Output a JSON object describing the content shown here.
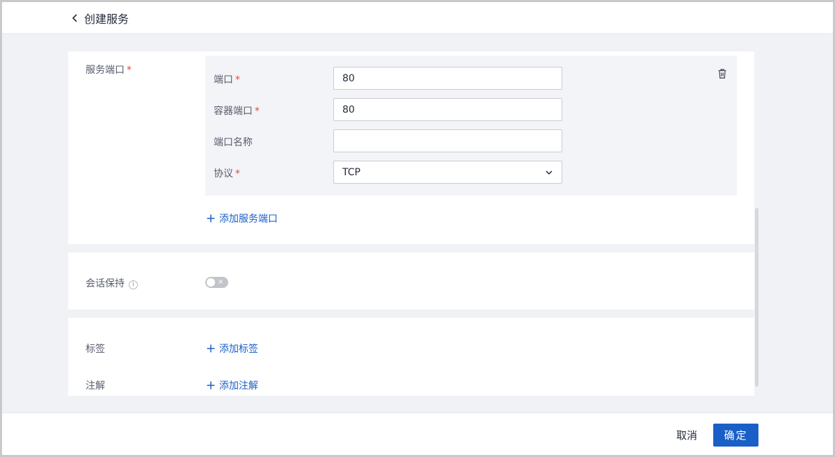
{
  "header": {
    "title": "创建服务",
    "back_icon": "chevron-left-icon"
  },
  "service_port": {
    "label": "服务端口",
    "required_mark": "*",
    "port": {
      "label": "端口",
      "required_mark": "*",
      "value": "80"
    },
    "container_port": {
      "label": "容器端口",
      "required_mark": "*",
      "value": "80"
    },
    "port_name": {
      "label": "端口名称",
      "value": ""
    },
    "protocol": {
      "label": "协议",
      "required_mark": "*",
      "value": "TCP"
    },
    "add_label": "添加服务端口",
    "delete_icon": "trash-icon"
  },
  "session_affinity": {
    "label": "会话保持",
    "info_glyph": "i",
    "toggle_on": false,
    "toggle_off_glyph": "×"
  },
  "labels": {
    "label": "标签",
    "add_label": "添加标签"
  },
  "annotations": {
    "label": "注解",
    "add_label": "添加注解"
  },
  "footer": {
    "cancel_label": "取消",
    "confirm_label": "确定"
  },
  "colors": {
    "accent": "#1a5fc7",
    "required": "#e8453c",
    "panel": "#f3f4f7",
    "background": "#f1f2f5"
  }
}
